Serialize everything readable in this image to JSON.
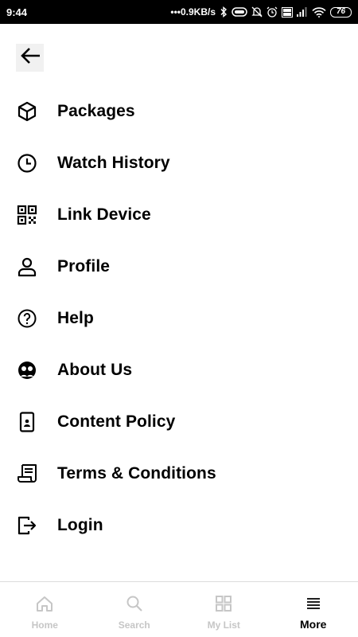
{
  "status_bar": {
    "time": "9:44",
    "network_speed": "•••0.9KB/s",
    "battery": "76"
  },
  "menu": {
    "items": [
      {
        "label": "Packages",
        "icon": "package-icon"
      },
      {
        "label": "Watch History",
        "icon": "clock-icon"
      },
      {
        "label": "Link Device",
        "icon": "qr-code-icon"
      },
      {
        "label": "Profile",
        "icon": "person-icon"
      },
      {
        "label": "Help",
        "icon": "help-icon"
      },
      {
        "label": "About Us",
        "icon": "about-icon"
      },
      {
        "label": "Content Policy",
        "icon": "phone-policy-icon"
      },
      {
        "label": "Terms & Conditions",
        "icon": "document-icon"
      },
      {
        "label": "Login",
        "icon": "login-icon"
      }
    ]
  },
  "bottom_nav": {
    "items": [
      {
        "label": "Home",
        "icon": "home-icon",
        "active": false
      },
      {
        "label": "Search",
        "icon": "search-icon",
        "active": false
      },
      {
        "label": "My List",
        "icon": "grid-icon",
        "active": false
      },
      {
        "label": "More",
        "icon": "menu-icon",
        "active": true
      }
    ]
  },
  "colors": {
    "inactive_nav": "#c6c6c6",
    "active_nav": "#000000",
    "status_bar": "#000000"
  }
}
